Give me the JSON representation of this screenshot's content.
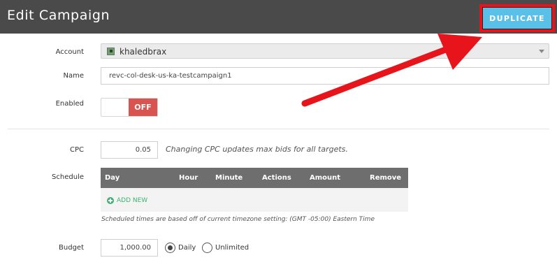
{
  "header": {
    "title": "Edit Campaign",
    "duplicate_label": "DUPLICATE"
  },
  "form": {
    "account": {
      "label": "Account",
      "value": "khaledbrax",
      "icon": "account-icon"
    },
    "name": {
      "label": "Name",
      "value": "revc-col-desk-us-ka-testcampaign1"
    },
    "enabled": {
      "label": "Enabled",
      "state": "OFF"
    },
    "cpc": {
      "label": "CPC",
      "value": "0.05",
      "hint": "Changing CPC updates max bids for all targets."
    },
    "schedule": {
      "label": "Schedule",
      "columns": [
        "Day",
        "Hour",
        "Minute",
        "Actions",
        "Amount",
        "Remove"
      ],
      "add_label": "ADD NEW",
      "note": "Scheduled times are based off of current timezone setting: (GMT -05:00) Eastern Time"
    },
    "budget": {
      "label": "Budget",
      "value": "1,000.00",
      "options": [
        {
          "label": "Daily",
          "selected": true
        },
        {
          "label": "Unlimited",
          "selected": false
        }
      ]
    }
  },
  "colors": {
    "header_bg": "#4a4a4a",
    "duplicate_bg": "#5bc0e8",
    "highlight": "#e8141c",
    "toggle_off": "#d9534f",
    "add_green": "#3cb371"
  }
}
